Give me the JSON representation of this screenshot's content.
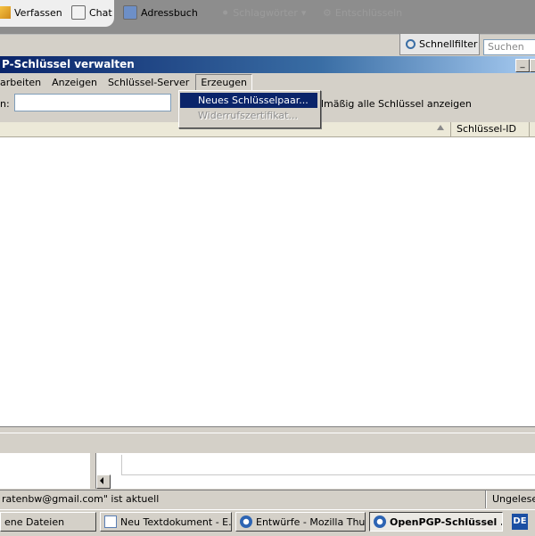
{
  "toolbar": {
    "compose": "Verfassen",
    "chat": "Chat",
    "addressbook": "Adressbuch",
    "tags": "Schlagwörter",
    "decrypt": "Entschlüsseln",
    "quickfilter": "Schnellfilter",
    "search_placeholder": "Suchen"
  },
  "window": {
    "title": "P-Schlüssel verwalten"
  },
  "menu": {
    "edit": "arbeiten",
    "view": "Anzeigen",
    "keyserver": "Schlüssel-Server",
    "generate": "Erzeugen"
  },
  "dropdown": {
    "items": [
      "Neues Schlüsselpaar...",
      "Widerrufszertifikat..."
    ]
  },
  "filter": {
    "label": "n:",
    "value": "",
    "show_all": "dmäßig alle Schlüssel anzeigen"
  },
  "columns": {
    "keyid": "Schlüssel-ID"
  },
  "status": {
    "text": "ratenbw@gmail.com\" ist aktuell",
    "right": "Ungelesen"
  },
  "taskbar": {
    "items": [
      "ene Dateien",
      "Neu Textdokument - E...",
      "Entwürfe - Mozilla Thu...",
      "OpenPGP-Schlüssel ..."
    ],
    "lang": "DE"
  }
}
